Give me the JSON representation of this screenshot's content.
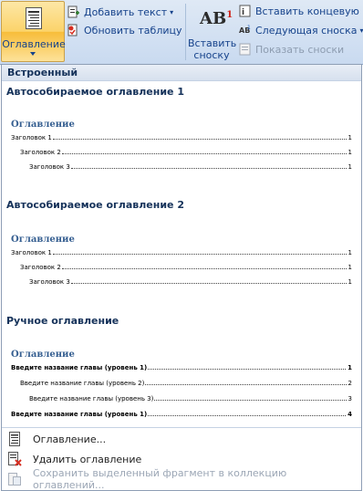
{
  "ribbon": {
    "toc_button_label": "Оглавление",
    "add_text_label": "Добавить текст",
    "update_table_label": "Обновить таблицу",
    "insert_footnote_label": "Вставить\nсноску",
    "insert_endnote_label": "Вставить концевую сн",
    "next_footnote_label": "Следующая сноска",
    "show_notes_label": "Показать сноски"
  },
  "gallery": {
    "section_header": "Встроенный",
    "items": [
      {
        "title": "Автособираемое оглавление 1",
        "preview_heading": "Оглавление",
        "lines": [
          {
            "text": "Заголовок 1",
            "page": "1"
          },
          {
            "text": "Заголовок 2",
            "page": "1"
          },
          {
            "text": "Заголовок 3",
            "page": "1"
          }
        ]
      },
      {
        "title": "Автособираемое оглавление 2",
        "preview_heading": "Оглавление",
        "lines": [
          {
            "text": "Заголовок 1",
            "page": "1"
          },
          {
            "text": "Заголовок 2",
            "page": "1"
          },
          {
            "text": "Заголовок 3",
            "page": "1"
          }
        ]
      },
      {
        "title": "Ручное оглавление",
        "preview_heading": "Оглавление",
        "lines": [
          {
            "text": "Введите название главы (уровень 1)",
            "page": "1"
          },
          {
            "text": "Введите название главы (уровень 2)",
            "page": "2"
          },
          {
            "text": "Введите название главы (уровень 3)",
            "page": "3"
          },
          {
            "text": "Введите название главы (уровень 1)",
            "page": "4"
          }
        ]
      }
    ]
  },
  "menu": {
    "toc_dialog": "Оглавление...",
    "remove_toc": "Удалить оглавление",
    "save_selection": "Сохранить выделенный фрагмент в коллекцию оглавлений..."
  },
  "icons": {
    "toc": "table-of-contents-icon",
    "add_text": "add-text-icon",
    "update_table": "update-table-icon",
    "insert_endnote": "endnote-icon",
    "next_footnote": "next-footnote-icon",
    "show_notes": "show-notes-icon",
    "remove_toc": "remove-toc-icon",
    "save_selection": "save-selection-icon"
  },
  "colors": {
    "ribbon_text": "#15428b",
    "preview_heading": "#365f91",
    "active_button": "#fbd36a"
  }
}
